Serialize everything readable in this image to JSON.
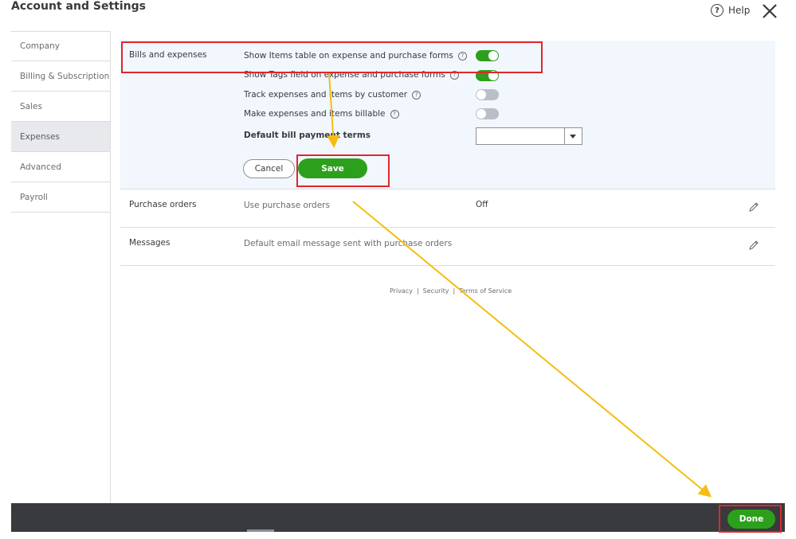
{
  "header": {
    "title": "Account and Settings",
    "help_label": "Help",
    "help_icon": "?"
  },
  "sidebar": {
    "items": [
      {
        "label": "Company"
      },
      {
        "label": "Billing & Subscription"
      },
      {
        "label": "Sales"
      },
      {
        "label": "Expenses",
        "active": true
      },
      {
        "label": "Advanced"
      },
      {
        "label": "Payroll"
      }
    ]
  },
  "bills": {
    "section_label": "Bills and expenses",
    "options": [
      {
        "label": "Show Items table on expense and purchase forms",
        "state": "on"
      },
      {
        "label": "Show Tags field on expense and purchase forms",
        "state": "on"
      },
      {
        "label": "Track expenses and items by customer",
        "state": "off"
      },
      {
        "label": "Make expenses and items billable",
        "state": "off"
      }
    ],
    "help_glyph": "?",
    "payment_terms_label": "Default bill payment terms",
    "payment_terms_value": "",
    "cancel_label": "Cancel",
    "save_label": "Save"
  },
  "purchase_orders": {
    "section_label": "Purchase orders",
    "description": "Use purchase orders",
    "value": "Off"
  },
  "messages": {
    "section_label": "Messages",
    "description": "Default email message sent with purchase orders"
  },
  "footer": {
    "privacy": "Privacy",
    "security": "Security",
    "terms": "Terms of Service",
    "separator": "|"
  },
  "bottom_bar": {
    "done_label": "Done"
  },
  "colors": {
    "accent_green": "#2ca01c",
    "highlight_red": "#e0262c",
    "arrow_yellow": "#f5bd0f",
    "bottom_bar": "#393a3d"
  }
}
